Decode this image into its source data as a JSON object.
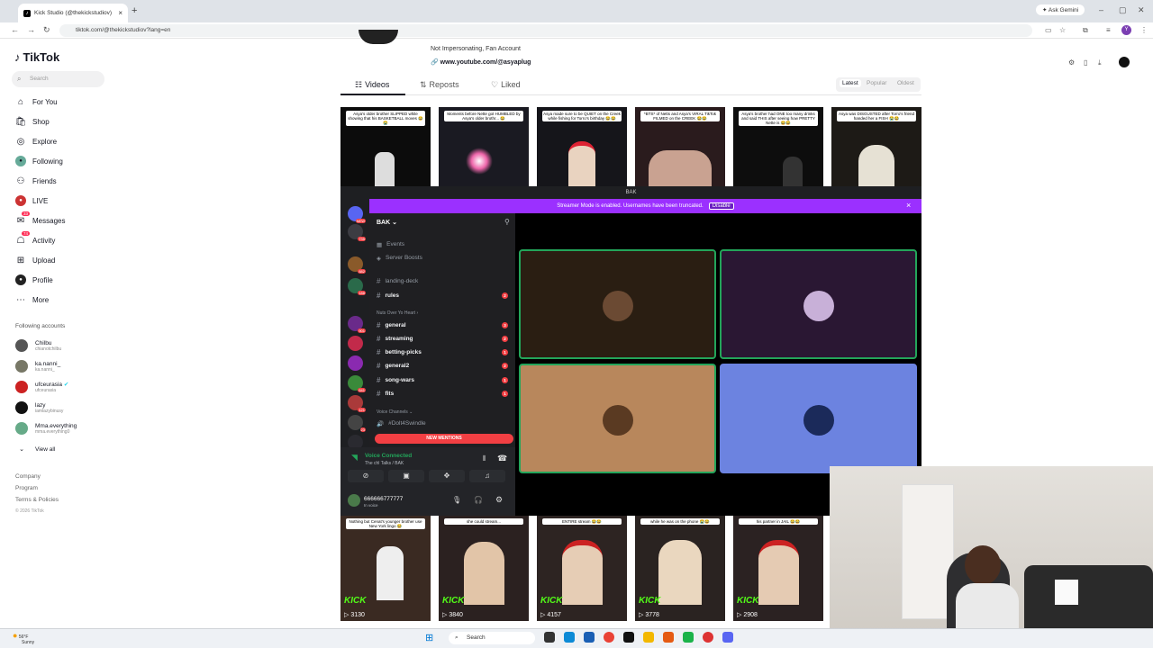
{
  "browser": {
    "tab_title": "Kick Studio (@thekickstudiov)",
    "url": "tiktok.com/@thekickstudiov?lang=en",
    "ask_gemini": "Ask Gemini"
  },
  "tiktok": {
    "logo": "TikTok",
    "search_placeholder": "Search",
    "nav": [
      {
        "label": "For You",
        "icon": "home-icon"
      },
      {
        "label": "Shop",
        "icon": "shop-icon"
      },
      {
        "label": "Explore",
        "icon": "compass-icon"
      },
      {
        "label": "Following",
        "icon": "following-icon"
      },
      {
        "label": "Friends",
        "icon": "friends-icon"
      },
      {
        "label": "LIVE",
        "icon": "live-icon"
      },
      {
        "label": "Messages",
        "icon": "message-icon",
        "badge": "33"
      },
      {
        "label": "Activity",
        "icon": "activity-icon",
        "badge": "74"
      },
      {
        "label": "Upload",
        "icon": "upload-icon"
      },
      {
        "label": "Profile",
        "icon": "profile-icon"
      },
      {
        "label": "More",
        "icon": "more-icon"
      }
    ],
    "following_header": "Following accounts",
    "accounts": [
      {
        "name": "Chilbu",
        "handle": "chianotchilbu"
      },
      {
        "name": "ka.nanni_",
        "handle": "ka.nanni_"
      },
      {
        "name": "ufceurasia",
        "handle": "ufceurasia"
      },
      {
        "name": "lazy",
        "handle": "iamlazybinusy"
      },
      {
        "name": "Mma.everything",
        "handle": "mma.everything0"
      }
    ],
    "view_all": "View all",
    "footer": [
      "Company",
      "Program",
      "Terms & Policies",
      "© 2026 TikTok"
    ]
  },
  "profile": {
    "bio_line": "Not Impersonating, Fan Account",
    "link": "www.youtube.com/@asyaplug",
    "tabs": [
      "Videos",
      "Reposts",
      "Liked"
    ],
    "sort": [
      "Latest",
      "Popular",
      "Oldest"
    ],
    "top_videos": [
      {
        "caption": "Asya's older brother SLIPPED while showing that his BASKETBALL moves 😂😭"
      },
      {
        "caption": "Moments before Nette got HUMBLED by Asya's older brothr... 😂"
      },
      {
        "caption": "Asya made sure to be QUIET on the Creek while fishing for Torro's birthday 😂😂"
      },
      {
        "caption": "*BTS* of Netts and Asya's VIRAL TikTok FILMED on the CREEK 😂😂"
      },
      {
        "caption": "Asya's brother had ONE too many drinks and said THIS after seeing how PRETTY Nette is 😂😂"
      },
      {
        "caption": "Asya was DISGUSTED after Torro's friend handed her a FISH 😭😂"
      }
    ],
    "bottom_videos": [
      {
        "caption": "Nothing but Cenat's younger brother use New York lingo 😂",
        "views": "3130"
      },
      {
        "caption": "she could stream...",
        "views": "3840"
      },
      {
        "caption": "ENTIRE stream 😂😂",
        "views": "4157"
      },
      {
        "caption": "while he was on the phone 😭😂",
        "views": "3778"
      },
      {
        "caption": "his partner in JAIL 😂😂",
        "views": "2908"
      }
    ],
    "kick_label": "KICK"
  },
  "discord": {
    "title": "BAK",
    "banner": "Streamer Mode is enabled. Usernames have been truncated.",
    "banner_button": "Disable",
    "server_name": "BAK",
    "channels": [
      {
        "name": "Events",
        "kind": "calendar"
      },
      {
        "name": "Server Boosts",
        "kind": "boost"
      },
      {
        "name": "landing-deck",
        "kind": "hash"
      },
      {
        "name": "rules",
        "kind": "hash",
        "count": "2",
        "bold": true
      }
    ],
    "category1": "Nuts Over Yo Heart",
    "channels2": [
      {
        "name": "general",
        "count": "3"
      },
      {
        "name": "streaming",
        "count": "2"
      },
      {
        "name": "betting-picks",
        "count": "1"
      },
      {
        "name": "general2",
        "count": "2"
      },
      {
        "name": "song-wars",
        "count": "1"
      },
      {
        "name": "fits",
        "count": "1"
      }
    ],
    "voice_category": "Voice Channels",
    "voice_channel": "#Dolt4Swindle",
    "new_mentions": "NEW MENTIONS",
    "voice_connected": "Voice Connected",
    "voice_sub": "The chl Talks / BAK",
    "username": "666666777777",
    "user_status": "In voice",
    "guild_badges": [
      "NEW",
      "735",
      "882",
      "188",
      "901",
      "641",
      "121",
      "23",
      "NEW"
    ]
  },
  "taskbar": {
    "search": "Search",
    "weather_temp": "56°F",
    "weather_text": "Sunny"
  }
}
